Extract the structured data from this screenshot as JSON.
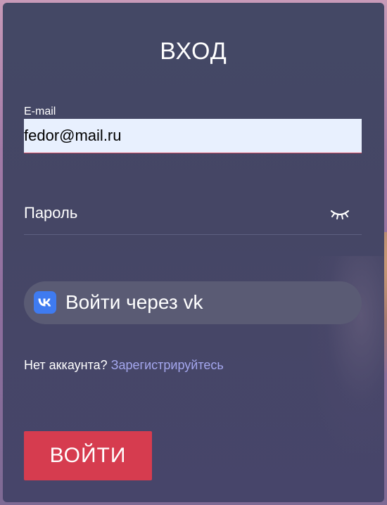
{
  "form": {
    "title": "ВХОД",
    "email": {
      "label": "E-mail",
      "value": "fedor@mail.ru"
    },
    "password": {
      "placeholder": "Пароль",
      "toggle_icon": "eye-closed-icon"
    },
    "vk_login": {
      "icon": "vk-logo-icon",
      "label": "Войти через vk"
    },
    "signup": {
      "prompt": "Нет аккаунта?",
      "link": "Зарегистрируйтесь"
    },
    "submit_label": "ВОЙТИ"
  },
  "colors": {
    "card_bg": "#454665",
    "autofill_bg": "#e8f0fe",
    "accent_red": "#d63c4f",
    "vk_blue": "#3f7bf0",
    "link": "#a4a7ee",
    "vk_button_bg": "#5a5b74"
  }
}
